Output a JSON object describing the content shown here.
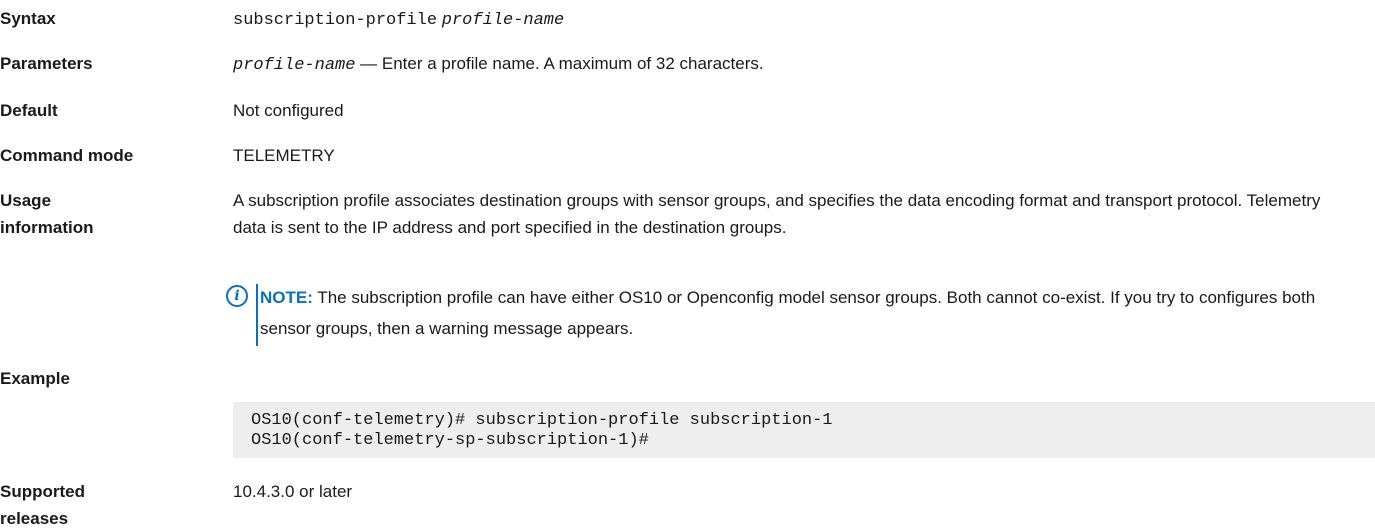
{
  "syntax": {
    "label": "Syntax",
    "command": "subscription-profile",
    "argument": "profile-name"
  },
  "parameters": {
    "label": "Parameters",
    "param": "profile-name",
    "description": " — Enter a profile name. A maximum of 32 characters."
  },
  "default": {
    "label": "Default",
    "value": "Not configured"
  },
  "command_mode": {
    "label": "Command mode",
    "value": "TELEMETRY"
  },
  "usage": {
    "label_line1": "Usage",
    "label_line2": "information",
    "text": "A subscription profile associates destination groups with sensor groups, and specifies the data encoding format and transport protocol. Telemetry data is sent to the IP address and port specified in the destination groups.",
    "note_icon": "info-icon",
    "note_label": "NOTE:",
    "note_text": " The subscription profile can have either OS10 or Openconfig model sensor groups. Both cannot co-exist. If you try to configures both sensor groups, then a warning message appears."
  },
  "example": {
    "label": "Example",
    "code_line1": "OS10(conf-telemetry)# subscription-profile subscription-1",
    "code_line2": "OS10(conf-telemetry-sp-subscription-1)#"
  },
  "supported": {
    "label_line1": "Supported",
    "label_line2": "releases",
    "value": "10.4.3.0 or later"
  },
  "colors": {
    "note_accent": "#0a72b8",
    "code_background": "#eeeeee"
  }
}
